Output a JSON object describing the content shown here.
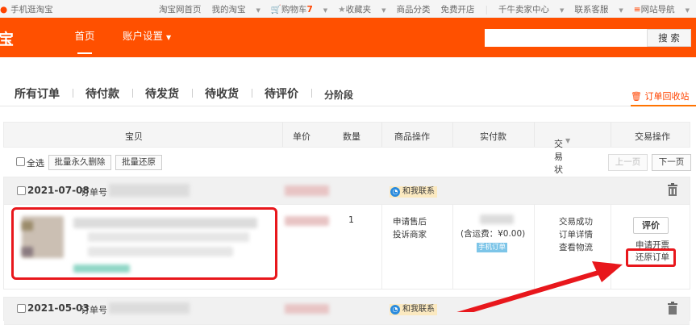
{
  "topbar": {
    "left_label": "手机逛淘宝",
    "links": {
      "home": "淘宝网首页",
      "my_taobao": "我的淘宝",
      "cart": "购物车",
      "cart_count": "7",
      "favorites": "收藏夹",
      "categories": "商品分类",
      "open_shop": "免费开店",
      "seller_center": "千牛卖家中心",
      "service": "联系客服",
      "site_nav": "网站导航"
    }
  },
  "header": {
    "logo": "宝",
    "nav_home": "首页",
    "nav_account": "账户设置",
    "search_placeholder": "",
    "search_button": "搜 索"
  },
  "tabs": {
    "all": "所有订单",
    "to_pay": "待付款",
    "to_ship": "待发货",
    "to_receive": "待收货",
    "to_review": "待评价",
    "installment": "分阶段",
    "recycle_bin": "订单回收站"
  },
  "table_header": {
    "item": "宝贝",
    "unit_price": "单价",
    "quantity": "数量",
    "item_ops": "商品操作",
    "paid": "实付款",
    "status": "交易状态",
    "trade_ops": "交易操作"
  },
  "batch": {
    "select_all": "全选",
    "batch_delete": "批量永久删除",
    "batch_restore": "批量还原",
    "prev_page": "上一页",
    "next_page": "下一页"
  },
  "orders": [
    {
      "date": "2021-07-08",
      "order_no_label": "订单号",
      "contact": "和我联系",
      "quantity": "1",
      "item_ops": [
        "申请售后",
        "投诉商家"
      ],
      "paid_note": "(含运费：¥0.00)",
      "phone_badge": "手机订单",
      "status": [
        "交易成功",
        "订单详情",
        "查看物流"
      ],
      "review_button": "评价",
      "invoice": "申请开票",
      "restore": "还原订单"
    },
    {
      "date": "2021-05-03",
      "order_no_label": "订单号",
      "contact": "和我联系"
    }
  ],
  "colors": {
    "brand_orange": "#ff5000",
    "annotation_red": "#e8171c"
  }
}
